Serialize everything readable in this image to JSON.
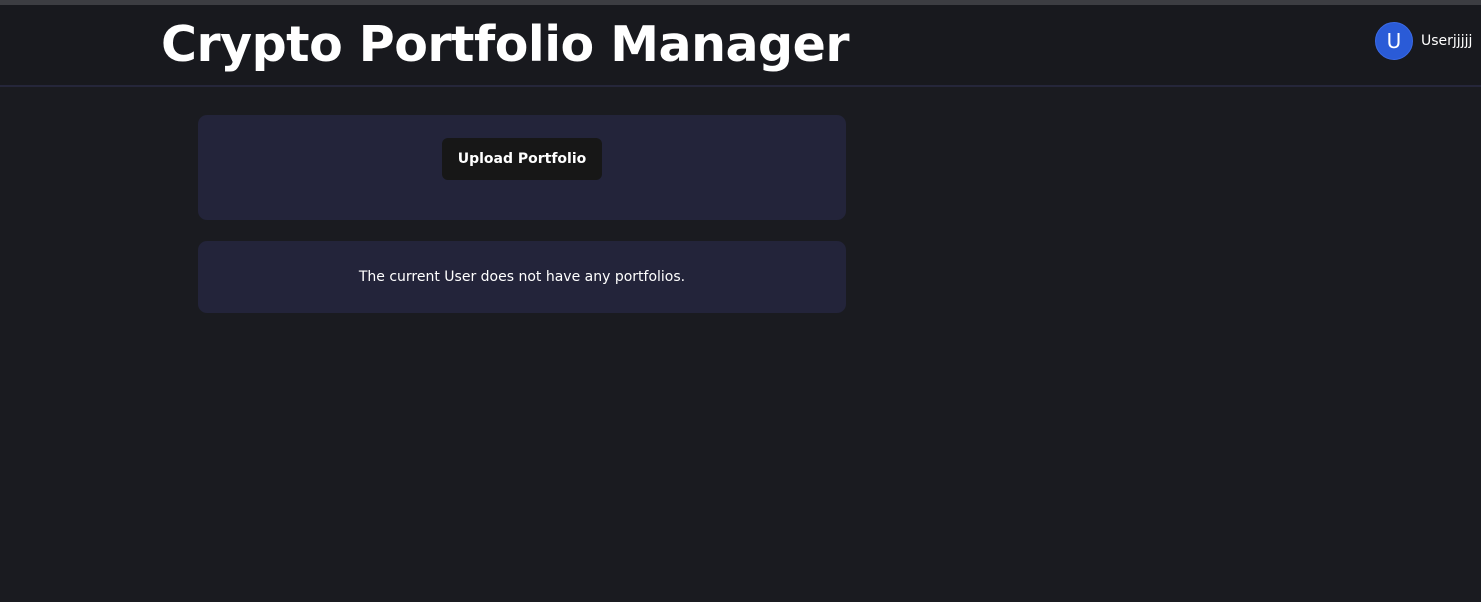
{
  "header": {
    "title": "Crypto Portfolio Manager",
    "user": {
      "avatar_initial": "U",
      "name": "Userjjjjj"
    }
  },
  "main": {
    "upload_button_label": "Upload Portfolio",
    "empty_message": "The current User does not have any portfolios."
  },
  "colors": {
    "background": "#1a1b20",
    "card": "#23243a",
    "avatar": "#2a5bd7",
    "button": "#171717"
  }
}
